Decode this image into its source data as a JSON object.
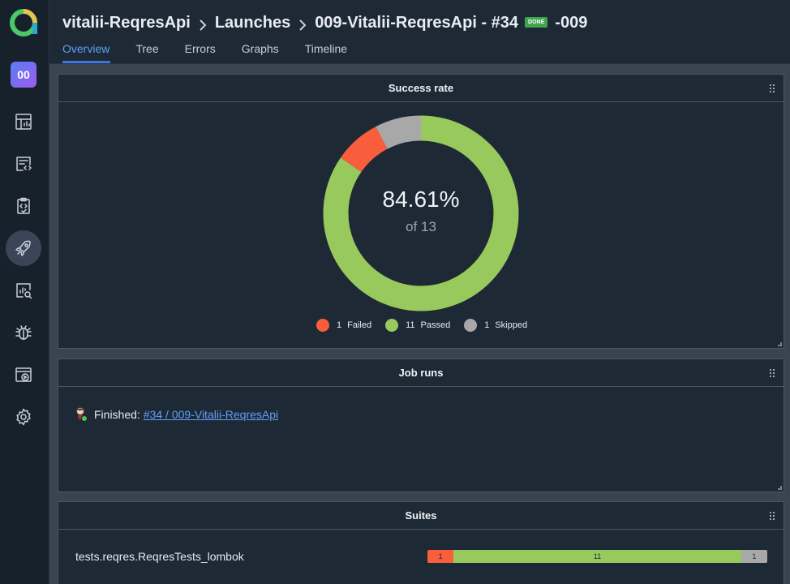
{
  "header": {
    "breadcrumb": {
      "project": "vitalii-ReqresApi",
      "section": "Launches",
      "launch": "009-Vitalii-ReqresApi - #34",
      "status_badge": "DONE",
      "suffix": "-009"
    },
    "tabs": [
      {
        "label": "Overview",
        "active": true
      },
      {
        "label": "Tree",
        "active": false
      },
      {
        "label": "Errors",
        "active": false
      },
      {
        "label": "Graphs",
        "active": false
      },
      {
        "label": "Timeline",
        "active": false
      }
    ]
  },
  "sidebar": {
    "avatar": "00",
    "items": [
      {
        "icon": "dashboard-icon"
      },
      {
        "icon": "test-cases-icon"
      },
      {
        "icon": "test-plans-icon"
      },
      {
        "icon": "launches-rocket-icon",
        "active": true
      },
      {
        "icon": "analytics-search-icon"
      },
      {
        "icon": "defects-bug-icon"
      },
      {
        "icon": "jobs-play-icon"
      },
      {
        "icon": "settings-gear-icon"
      }
    ]
  },
  "success_rate": {
    "title": "Success rate",
    "percent": "84.61%",
    "subtitle": "of 13",
    "legend": [
      {
        "count": "1",
        "label": "Failed",
        "color": "#f95e3c"
      },
      {
        "count": "11",
        "label": "Passed",
        "color": "#97c95c"
      },
      {
        "count": "1",
        "label": "Skipped",
        "color": "#a8a8a8"
      }
    ]
  },
  "job_runs": {
    "title": "Job runs",
    "status_text": "Finished:",
    "link_text": "#34 / 009-Vitalii-ReqresApi"
  },
  "suites": {
    "title": "Suites",
    "rows": [
      {
        "name": "tests.reqres.ReqresTests_lombok",
        "failed": 1,
        "passed": 11,
        "skipped": 1
      }
    ]
  },
  "colors": {
    "accent": "#3d74e0",
    "failed": "#f95e3c",
    "passed": "#97c95c",
    "skipped": "#a8a8a8",
    "done_badge": "#3fa650"
  }
}
